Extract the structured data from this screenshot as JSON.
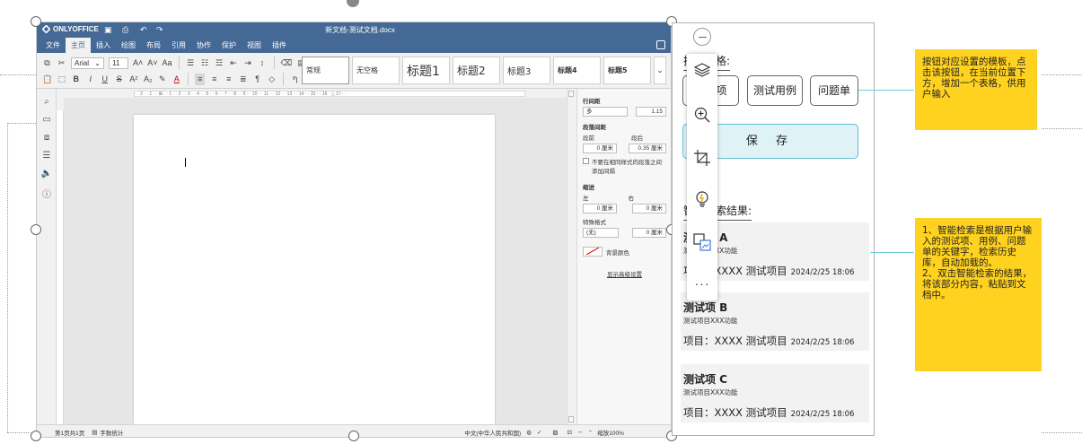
{
  "editor": {
    "app_name": "ONLYOFFICE",
    "doc_title": "新文档-测试文档.docx",
    "menu": [
      "文件",
      "主页",
      "插入",
      "绘图",
      "布局",
      "引用",
      "协作",
      "保护",
      "视图",
      "插件"
    ],
    "active_menu_index": 1,
    "font_name": "Arial",
    "font_size": "11",
    "styles": [
      "常规",
      "无空格",
      "标题1",
      "标题2",
      "标题3",
      "标题4",
      "标题5"
    ],
    "panel": {
      "line_spacing_label": "行间距",
      "line_spacing_type": "多",
      "line_spacing_value": "1.15",
      "para_spacing_label": "段落间距",
      "before_label": "段前",
      "after_label": "段后",
      "before_value": "0 厘米",
      "after_value": "0.35 厘米",
      "no_space_label": "不要在相同样式的段落之间添加间隔",
      "indent_label": "缩进",
      "left_label": "左",
      "right_label": "右",
      "left_value": "0 厘米",
      "right_value": "0 厘米",
      "special_label": "特殊格式",
      "special_value": "(无)",
      "special_amount": "0 厘米",
      "bg_color_label": "背景颜色",
      "advanced_link": "显示高级设置"
    },
    "status": {
      "pages": "第1页共1页",
      "word_count": "字数统计",
      "language": "中文(中华人民共和国)",
      "zoom": "缩放100%"
    }
  },
  "plugin": {
    "templates_heading": "插入表格:",
    "template_buttons": [
      "测试项",
      "测试用例",
      "问题单"
    ],
    "save_label": "保 存",
    "results_heading": "智能检索结果:",
    "results": [
      {
        "title": "测试项 A",
        "subtitle": "测试项目XXX功能",
        "line": "项目：XXXX 测试项目",
        "date": "2024/2/25 18:06"
      },
      {
        "title": "测试项 B",
        "subtitle": "测试项目XXX功能",
        "line": "项目：XXXX 测试项目",
        "date": "2024/2/25 18:06"
      },
      {
        "title": "测试项 C",
        "subtitle": "测试项目XXX功能",
        "line": "项目：XXXX 测试项目",
        "date": "2024/2/25 18:06"
      }
    ]
  },
  "float_icons": [
    "layers-icon",
    "zoom-in-icon",
    "crop-icon",
    "lightbulb-icon",
    "image-swap-icon",
    "more-icon"
  ],
  "callouts": {
    "template_note": "按钮对应设置的模板，点击该按钮，在当前位置下方，增加一个表格，供用户输入",
    "search_note_1": "1、智能检索是根据用户输入的测试项、用例、问题单的关键字，检索历史库，自动加载的。",
    "search_note_2": "2、双击智能检索的结果，将该部分内容，粘贴到文档中。"
  },
  "colors": {
    "editor_header": "#446995",
    "callout": "#ffd21f",
    "save_button_bg": "#dff3f7",
    "save_button_border": "#5fc0d3"
  }
}
